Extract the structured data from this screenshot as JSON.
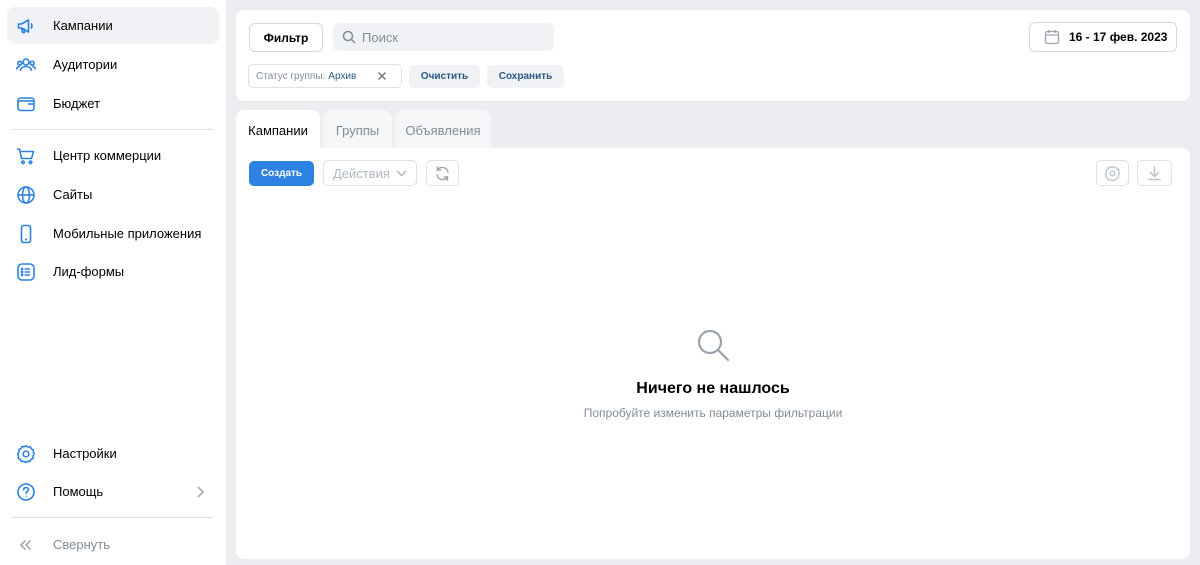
{
  "sidebar": {
    "items": [
      {
        "label": "Кампании",
        "icon": "megaphone-icon"
      },
      {
        "label": "Аудитории",
        "icon": "users-icon"
      },
      {
        "label": "Бюджет",
        "icon": "wallet-icon"
      },
      {
        "label": "Центр коммерции",
        "icon": "cart-icon"
      },
      {
        "label": "Сайты",
        "icon": "globe-icon"
      },
      {
        "label": "Мобильные приложения",
        "icon": "phone-icon"
      },
      {
        "label": "Лид-формы",
        "icon": "list-icon"
      }
    ],
    "settings_label": "Настройки",
    "help_label": "Помощь",
    "collapse_label": "Свернуть"
  },
  "filter": {
    "filter_button": "Фильтр",
    "search_placeholder": "Поиск",
    "date_range": "16 - 17 фев. 2023",
    "chip_key": "Статус группы:",
    "chip_value": "Архив",
    "clear_button": "Очистить",
    "save_button": "Сохранить"
  },
  "tabs": [
    {
      "label": "Кампании",
      "active": true
    },
    {
      "label": "Группы",
      "active": false
    },
    {
      "label": "Объявления",
      "active": false
    }
  ],
  "toolbar": {
    "create_button": "Создать",
    "actions_placeholder": "Действия"
  },
  "empty_state": {
    "title": "Ничего не нашлось",
    "subtitle": "Попробуйте изменить параметры фильтрации"
  },
  "colors": {
    "accent": "#2d81e0",
    "icon_blue": "#2d81e0",
    "link": "#2a5885",
    "muted": "#818c99",
    "background": "#ebedf0"
  }
}
